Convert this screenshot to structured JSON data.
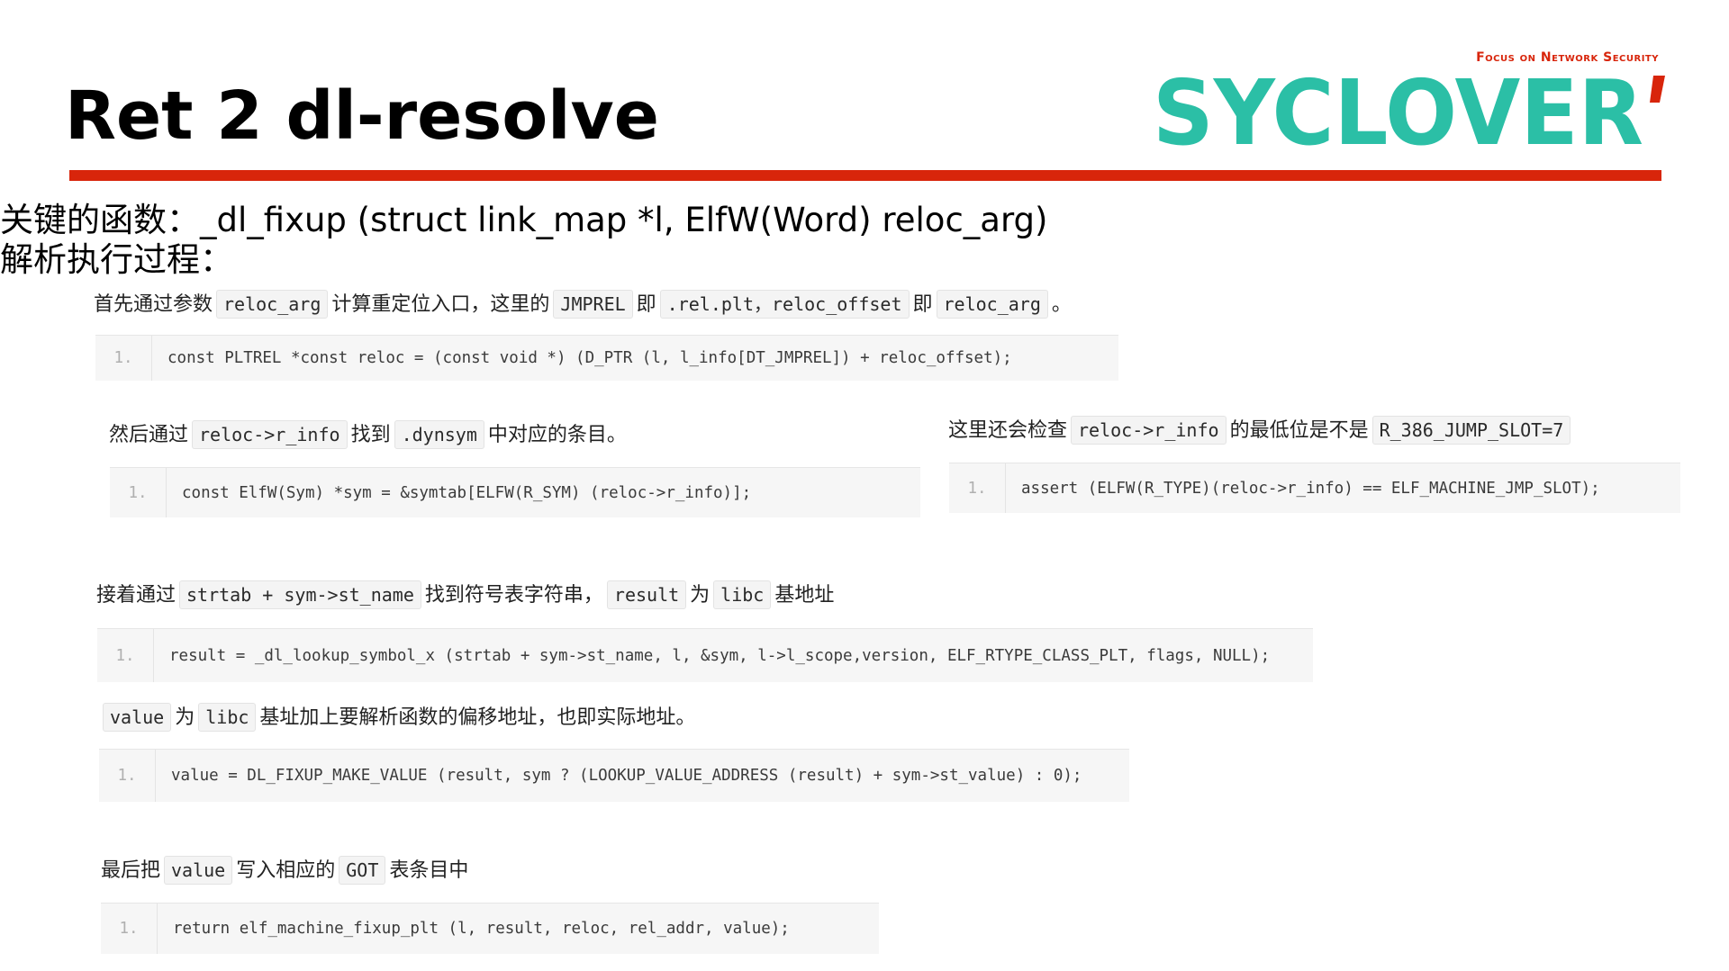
{
  "slide": {
    "title": "Ret 2 dl-resolve",
    "logo": {
      "tagline": "Focus on Network Security",
      "brand": "SYCLOVER"
    },
    "colors": {
      "rule": "#d8250b",
      "logo_teal": "#2bbfa6",
      "logo_red": "#d8250b"
    }
  },
  "intro": {
    "line1": "关键的函数：_dl_fixup (struct link_map *l, ElfW(Word) reloc_arg)",
    "line2": "解析执行过程："
  },
  "steps": [
    {
      "desc": [
        {
          "t": "首先通过参数"
        },
        {
          "c": "reloc_arg"
        },
        {
          "t": "计算重定位入口，这里的"
        },
        {
          "c": "JMPREL"
        },
        {
          "t": "即"
        },
        {
          "c": ".rel.plt，reloc_offset"
        },
        {
          "t": "即"
        },
        {
          "c": "reloc_arg"
        },
        {
          "t": "。"
        }
      ],
      "line_no": "1.",
      "code": "const PLTREL *const reloc = (const void *) (D_PTR (l, l_info[DT_JMPREL]) + reloc_offset);"
    },
    {
      "desc": [
        {
          "t": "然后通过"
        },
        {
          "c": "reloc->r_info"
        },
        {
          "t": "找到"
        },
        {
          "c": ".dynsym"
        },
        {
          "t": "中对应的条目。"
        }
      ],
      "line_no": "1.",
      "code": "const ElfW(Sym) *sym = &symtab[ELFW(R_SYM) (reloc->r_info)];"
    },
    {
      "desc": [
        {
          "t": "这里还会检查"
        },
        {
          "c": "reloc->r_info"
        },
        {
          "t": "的最低位是不是"
        },
        {
          "c": "R_386_JUMP_SLOT=7"
        }
      ],
      "line_no": "1.",
      "code": "assert (ELFW(R_TYPE)(reloc->r_info) == ELF_MACHINE_JMP_SLOT);"
    },
    {
      "desc": [
        {
          "t": "接着通过"
        },
        {
          "c": "strtab + sym->st_name"
        },
        {
          "t": "找到符号表字符串，"
        },
        {
          "c": "result"
        },
        {
          "t": "为"
        },
        {
          "c": "libc"
        },
        {
          "t": "基地址"
        }
      ],
      "line_no": "1.",
      "code": "result = _dl_lookup_symbol_x (strtab + sym->st_name, l, &sym, l->l_scope,version, ELF_RTYPE_CLASS_PLT, flags, NULL);"
    },
    {
      "desc": [
        {
          "c": "value"
        },
        {
          "t": "为"
        },
        {
          "c": "libc"
        },
        {
          "t": "基址加上要解析函数的偏移地址，也即实际地址。"
        }
      ],
      "line_no": "1.",
      "code": "value = DL_FIXUP_MAKE_VALUE (result, sym ? (LOOKUP_VALUE_ADDRESS (result) + sym->st_value) : 0);"
    },
    {
      "desc": [
        {
          "t": "最后把"
        },
        {
          "c": "value"
        },
        {
          "t": "写入相应的"
        },
        {
          "c": "GOT"
        },
        {
          "t": "表条目中"
        }
      ],
      "line_no": "1.",
      "code": "return elf_machine_fixup_plt (l, result, reloc, rel_addr, value);"
    }
  ]
}
